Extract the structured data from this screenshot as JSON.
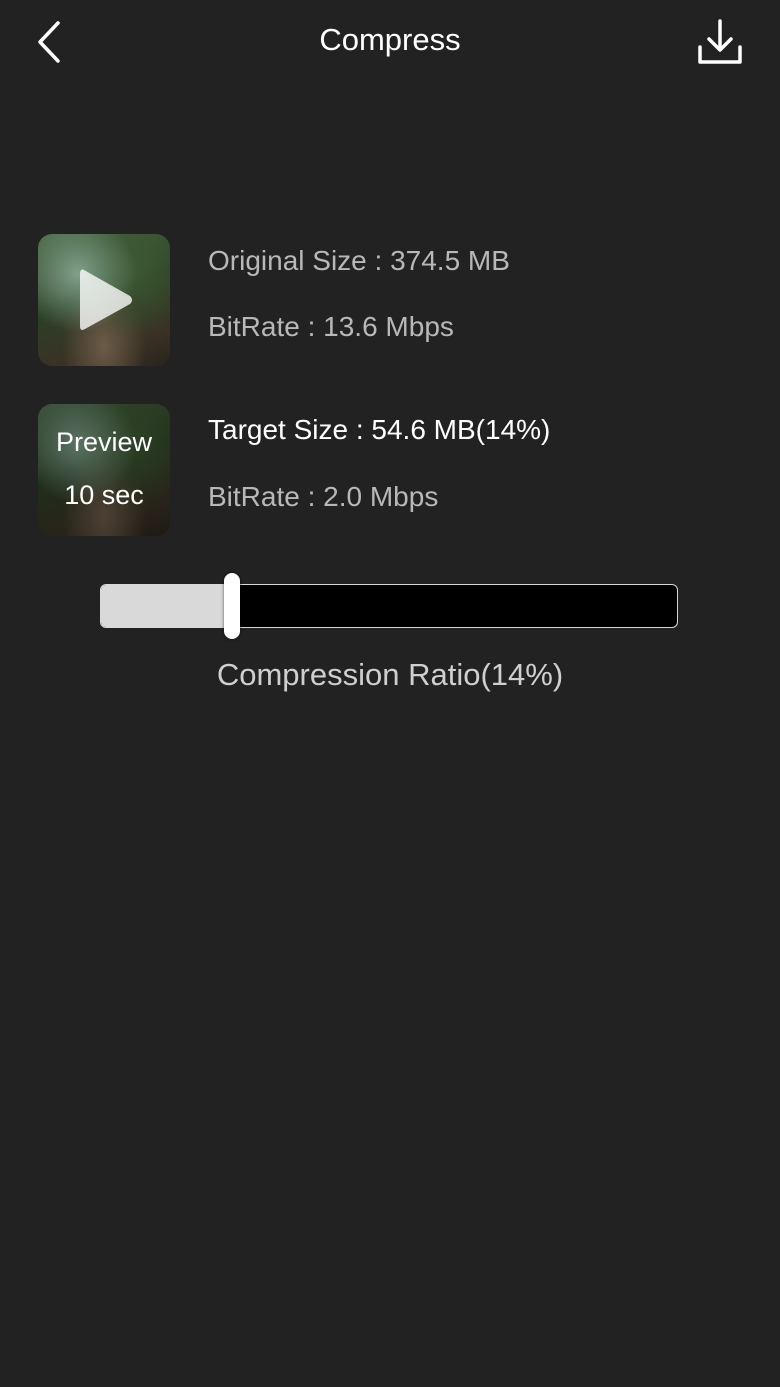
{
  "header": {
    "title": "Compress",
    "back_icon": "chevron-left-icon",
    "download_icon": "download-icon"
  },
  "original": {
    "thumbnail_icon": "play-icon",
    "size_text": "Original Size : 374.5 MB",
    "bitrate_text": "BitRate : 13.6 Mbps"
  },
  "target": {
    "preview_line1": "Preview",
    "preview_line2": "10 sec",
    "size_text": "Target Size : 54.6 MB(14%)",
    "bitrate_text": "BitRate : 2.0 Mbps"
  },
  "slider": {
    "value_percent": 14,
    "label": "Compression Ratio(14%)"
  },
  "colors": {
    "background": "#222222",
    "track": "#000000",
    "fill": "#d9d9d9",
    "secondary_text": "#b8b8b8"
  }
}
